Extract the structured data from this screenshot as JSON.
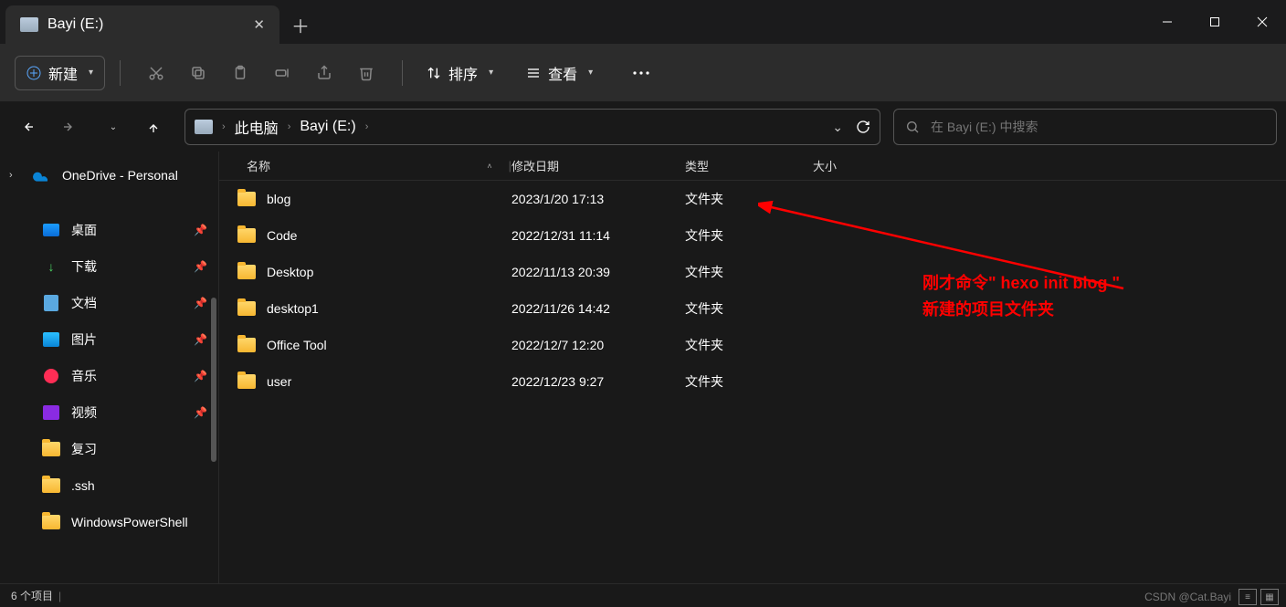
{
  "window": {
    "tab_title": "Bayi (E:)"
  },
  "toolbar": {
    "new_label": "新建",
    "sort_label": "排序",
    "view_label": "查看"
  },
  "breadcrumb": {
    "root": "此电脑",
    "current": "Bayi (E:)"
  },
  "search": {
    "placeholder": "在 Bayi (E:) 中搜索"
  },
  "sidebar": {
    "onedrive": "OneDrive - Personal",
    "items": [
      {
        "label": "桌面",
        "icon": "desktop"
      },
      {
        "label": "下载",
        "icon": "download"
      },
      {
        "label": "文档",
        "icon": "document"
      },
      {
        "label": "图片",
        "icon": "picture"
      },
      {
        "label": "音乐",
        "icon": "music"
      },
      {
        "label": "视频",
        "icon": "video"
      },
      {
        "label": "复习",
        "icon": "folder"
      },
      {
        "label": ".ssh",
        "icon": "folder"
      },
      {
        "label": "WindowsPowerShell",
        "icon": "folder"
      }
    ]
  },
  "columns": {
    "name": "名称",
    "date": "修改日期",
    "type": "类型",
    "size": "大小"
  },
  "files": [
    {
      "name": "blog",
      "date": "2023/1/20 17:13",
      "type": "文件夹"
    },
    {
      "name": "Code",
      "date": "2022/12/31 11:14",
      "type": "文件夹"
    },
    {
      "name": "Desktop",
      "date": "2022/11/13 20:39",
      "type": "文件夹"
    },
    {
      "name": "desktop1",
      "date": "2022/11/26 14:42",
      "type": "文件夹"
    },
    {
      "name": "Office Tool",
      "date": "2022/12/7 12:20",
      "type": "文件夹"
    },
    {
      "name": "user",
      "date": "2022/12/23 9:27",
      "type": "文件夹"
    }
  ],
  "annotation": {
    "line1": "刚才命令\" hexo init blog \"",
    "line2": "新建的项目文件夹"
  },
  "status": {
    "count": "6 个项目"
  },
  "watermark": "CSDN @Cat.Bayi"
}
